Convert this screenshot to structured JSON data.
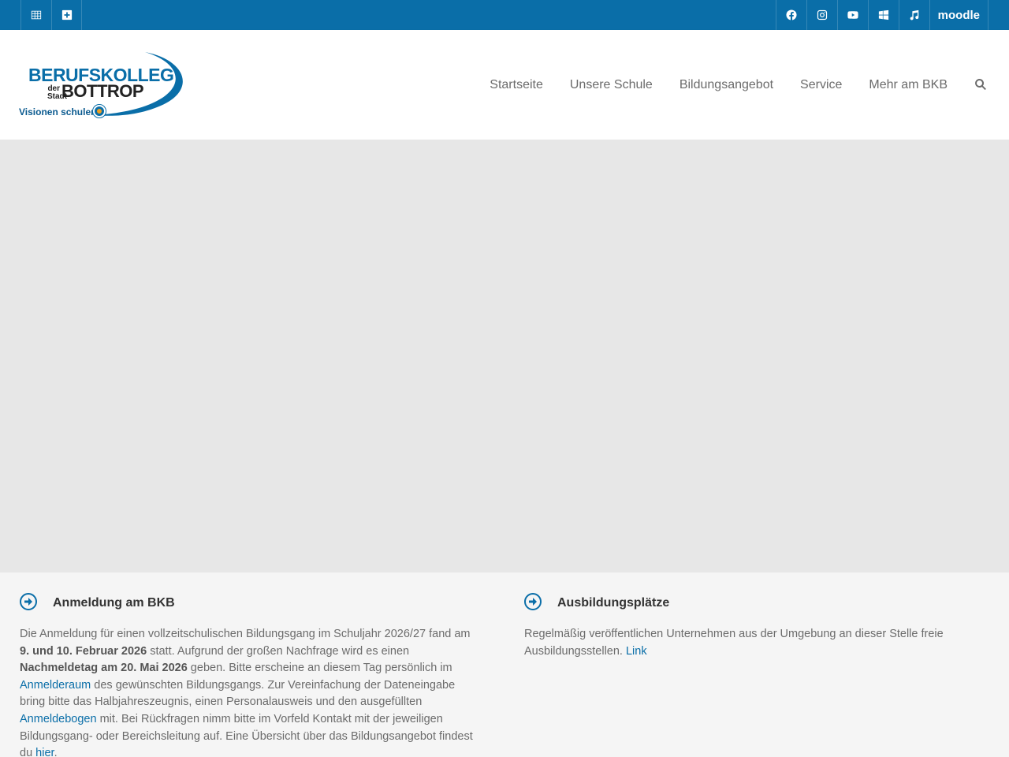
{
  "topbar": {
    "moodle_label": "moodle",
    "left_icons": [
      "table-icon",
      "plus-square-icon"
    ],
    "right_icons": [
      "facebook-icon",
      "instagram-icon",
      "youtube-icon",
      "windows-icon",
      "music-icon"
    ]
  },
  "logo": {
    "line1": "BERUFSKOLLEG",
    "der": "der",
    "stadt": "Stadt",
    "line2": "BOTTROP",
    "tagline": "Visionen schulen"
  },
  "nav": {
    "items": [
      "Startseite",
      "Unsere Schule",
      "Bildungsangebot",
      "Service",
      "Mehr am BKB"
    ]
  },
  "sections": {
    "left": {
      "title": "Anmeldung am BKB",
      "p1": "Die Anmeldung für einen vollzeitschulischen Bildungsgang im Schuljahr 2026/27 fand am ",
      "b1": "9. und 10. Februar 2026",
      "p2": " statt. Aufgrund der großen Nachfrage wird es einen ",
      "b2": "Nachmeldetag am 20. Mai 2026",
      "p3": " geben. Bitte erscheine an diesem Tag persönlich im ",
      "link1": "Anmelderaum",
      "p4": " des gewünschten Bildungsgangs. Zur Vereinfachung der Dateneingabe bring bitte das Halbjahreszeugnis, einen Personalausweis und den ausgefüllten ",
      "link2": "Anmeldebogen",
      "p5": " mit. Bei Rückfragen nimm bitte im Vorfeld Kontakt mit der jeweiligen Bildungsgang- oder Bereichsleitung auf. Eine Übersicht über das Bildungsangebot findest du ",
      "link3": "hier",
      "p6": "."
    },
    "right": {
      "title": "Ausbildungsplätze",
      "p1": "Regelmäßig veröffentlichen Unternehmen aus der Umgebung an dieser Stelle freie Ausbildungsstellen. ",
      "link1": "Link"
    }
  },
  "colors": {
    "brand_blue": "#0a6ea8",
    "hero_bg": "#e7e7e7",
    "content_bg": "#f5f5f5"
  }
}
